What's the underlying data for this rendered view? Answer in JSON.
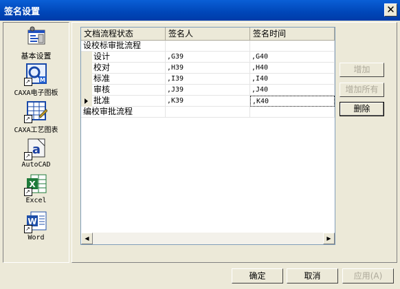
{
  "window": {
    "title": "签名设置",
    "close_glyph": "✕"
  },
  "sidebar": {
    "items": [
      {
        "label": "基本设置",
        "icon": "settings-icon"
      },
      {
        "label": "CAXA电子图板",
        "icon": "caxa-draft-icon"
      },
      {
        "label": "CAXA工艺图表",
        "icon": "caxa-process-icon"
      },
      {
        "label": "AutoCAD",
        "icon": "autocad-icon"
      },
      {
        "label": "Excel",
        "icon": "excel-icon"
      },
      {
        "label": "Word",
        "icon": "word-icon"
      }
    ]
  },
  "grid": {
    "headers": [
      "文档流程状态",
      "签名人",
      "签名时间"
    ],
    "rows": [
      {
        "status": "设校标审批流程",
        "signer": "",
        "time": "",
        "group": true
      },
      {
        "status": "设计",
        "signer": ",G39",
        "time": ",G40"
      },
      {
        "status": "校对",
        "signer": ",H39",
        "time": ",H40"
      },
      {
        "status": "标准",
        "signer": ",I39",
        "time": ",I40"
      },
      {
        "status": "审核",
        "signer": ",J39",
        "time": ",J40"
      },
      {
        "status": "批准",
        "signer": ",K39",
        "time": ",K40",
        "current": true
      },
      {
        "status": "编校审批流程",
        "signer": "",
        "time": "",
        "group": true
      }
    ],
    "scroll_left": "◀",
    "scroll_right": "▶",
    "row_marker": "▶"
  },
  "actions": {
    "add": "增加",
    "add_all": "增加所有",
    "delete": "删除"
  },
  "footer": {
    "ok": "确定",
    "cancel": "取消",
    "apply": "应用(A)"
  }
}
